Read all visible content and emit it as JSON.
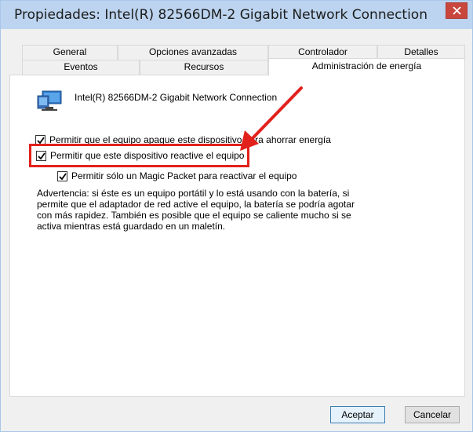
{
  "window": {
    "title": "Propiedades: Intel(R) 82566DM-2 Gigabit Network Connection"
  },
  "tabs_back": [
    {
      "label": "General"
    },
    {
      "label": "Opciones avanzadas"
    },
    {
      "label": "Controlador"
    },
    {
      "label": "Detalles"
    }
  ],
  "tabs_front": [
    {
      "label": "Eventos"
    },
    {
      "label": "Recursos"
    },
    {
      "label": "Administración de energía",
      "active": true
    }
  ],
  "device": {
    "name": "Intel(R) 82566DM-2 Gigabit Network Connection",
    "icon": "network-adapter-icon"
  },
  "options": [
    {
      "label": "Permitir que el equipo apague este dispositivo para ahorrar energía",
      "checked": true
    },
    {
      "label": "Permitir que este dispositivo reactive el equipo",
      "checked": true
    },
    {
      "label": "Permitir sólo un Magic Packet para reactivar el equipo",
      "checked": true
    }
  ],
  "warning_text": "Advertencia: si éste es un equipo portátil y lo está usando con la batería, si permite que el adaptador de red active el equipo, la batería se podría agotar con más rapidez. También es posible que el equipo se caliente mucho si se activa mientras está guardado en un maletín.",
  "buttons": {
    "ok": "Aceptar",
    "cancel": "Cancelar"
  },
  "colors": {
    "annotation": "#e2211c",
    "titlebar": "#bcd4ef",
    "close_button": "#c9463d"
  }
}
